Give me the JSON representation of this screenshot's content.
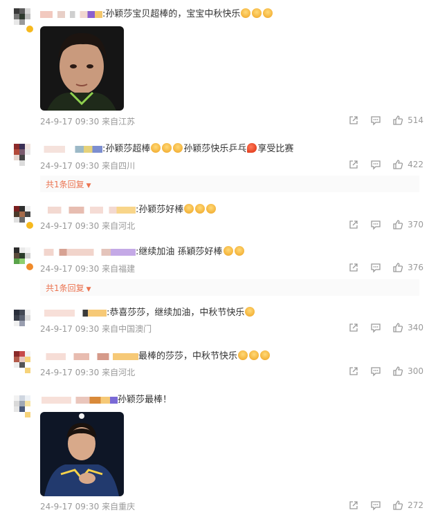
{
  "comments": [
    {
      "text": ":孙颖莎宝贝超棒的，宝宝中秋快乐",
      "emojis": [
        "kiss",
        "kiss",
        "kiss"
      ],
      "time": "24-9-17 09:30",
      "location": "来自江苏",
      "likes": "514"
    },
    {
      "text": ":孙颖莎超棒",
      "text2": "孙颖莎快乐乒乓",
      "text3": "享受比赛",
      "time": "24-9-17 09:30",
      "location": "来自四川",
      "likes": "422",
      "reply_label": "共1条回复"
    },
    {
      "text": ":孙颖莎好棒",
      "time": "24-9-17 09:30",
      "location": "来自河北",
      "likes": "370"
    },
    {
      "text": ":继续加油 孫穎莎好棒",
      "time": "24-9-17 09:30",
      "location": "来自福建",
      "likes": "376",
      "reply_label": "共1条回复"
    },
    {
      "text": ":恭喜莎莎，继续加油，中秋节快乐",
      "time": "24-9-17 09:30",
      "location": "来自中国澳门",
      "likes": "340"
    },
    {
      "text": "最棒的莎莎，中秋节快乐",
      "time": "24-9-17 09:30",
      "location": "来自河北",
      "likes": "300"
    },
    {
      "text": "孙颖莎最棒！",
      "time": "24-9-17 09:30",
      "location": "来自重庆",
      "likes": "272"
    }
  ],
  "icons": {
    "share": "share-icon",
    "comment": "comment-icon",
    "like": "thumbs-up-icon"
  },
  "colors": {
    "meta": "#999999",
    "reply": "#eb7350",
    "text": "#333333"
  }
}
